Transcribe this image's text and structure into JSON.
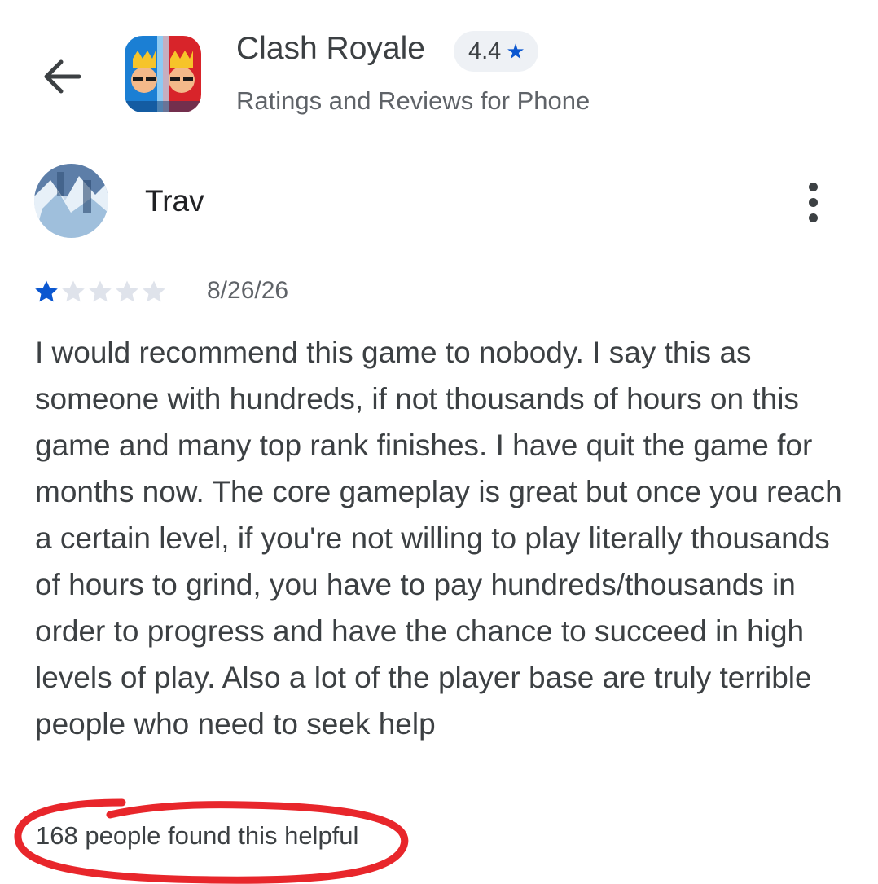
{
  "header": {
    "back_icon": "arrow-left-icon",
    "app_icon": "clash-royale-app-icon",
    "app_title": "Clash Royale",
    "rating": "4.4",
    "rating_star_icon": "star-icon",
    "subtitle": "Ratings and Reviews for Phone"
  },
  "review": {
    "reviewer_name": "Trav",
    "avatar_icon": "user-avatar",
    "more_icon": "more-vert-icon",
    "star_rating": 1,
    "star_max": 5,
    "date": "8/26/26",
    "text": "I would recommend this game to nobody. I say this as someone with hundreds, if not thousands of hours on this game and many top rank finishes. I have quit the game for months now. The core gameplay is great but once you reach a certain level, if you're not willing to play literally thousands of hours to grind, you have to pay hundreds/thousands in order to progress and have the chance to succeed in high levels of play. Also a lot of the player base are truly terrible people who need to seek help",
    "helpful_text": "168 people found this helpful"
  },
  "colors": {
    "accent": "#0b57d0",
    "star_filled": "#0b57d0",
    "star_empty": "#dfe3eb",
    "annotation": "#e8262b",
    "text": "#3c4043"
  }
}
